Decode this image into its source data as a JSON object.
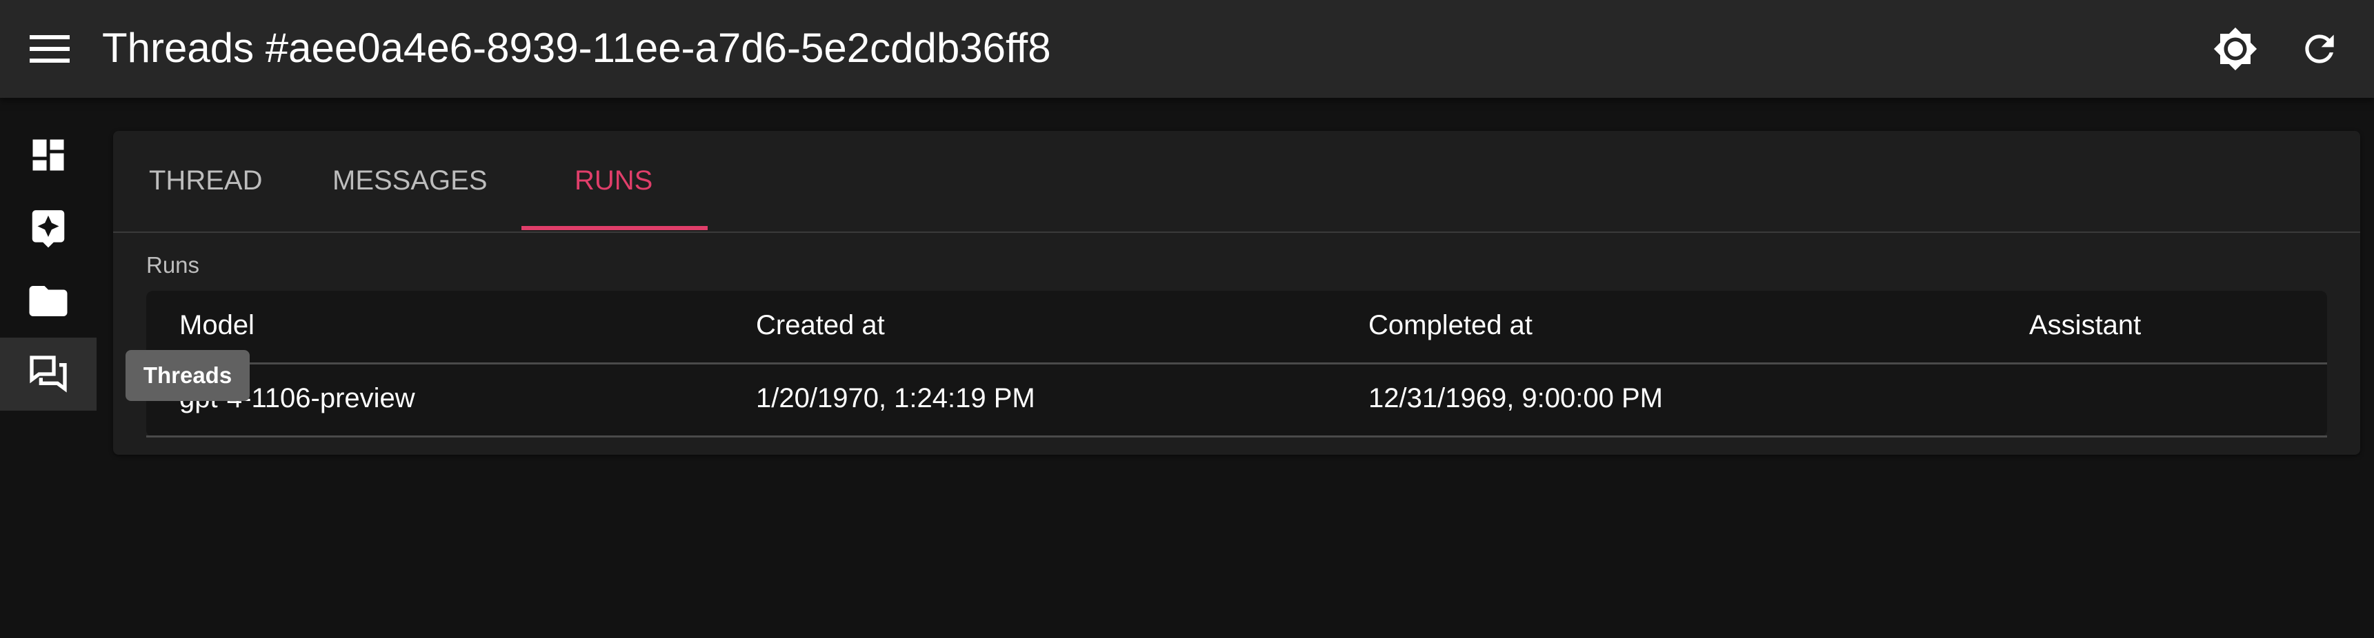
{
  "appbar": {
    "title": "Threads #aee0a4e6-8939-11ee-a7d6-5e2cddb36ff8"
  },
  "sidebar": {
    "items": [
      {
        "icon": "dashboard-icon",
        "label": "Dashboard"
      },
      {
        "icon": "assistant-icon",
        "label": "Assistants"
      },
      {
        "icon": "folder-icon",
        "label": "Files"
      },
      {
        "icon": "forum-icon",
        "label": "Threads"
      }
    ],
    "active_index": 3
  },
  "tooltip": {
    "text": "Threads"
  },
  "tabs": [
    {
      "label": "THREAD"
    },
    {
      "label": "MESSAGES"
    },
    {
      "label": "RUNS"
    }
  ],
  "runs": {
    "section_label": "Runs",
    "columns": [
      "Model",
      "Created at",
      "Completed at",
      "Assistant"
    ],
    "rows": [
      {
        "model": "gpt-4-1106-preview",
        "created_at": "1/20/1970, 1:24:19 PM",
        "completed_at": "12/31/1969, 9:00:00 PM",
        "assistant": ""
      }
    ]
  },
  "colors": {
    "accent": "#e03e6a",
    "background": "#121212",
    "appbar": "#272727",
    "panel": "#1e1e1e"
  }
}
